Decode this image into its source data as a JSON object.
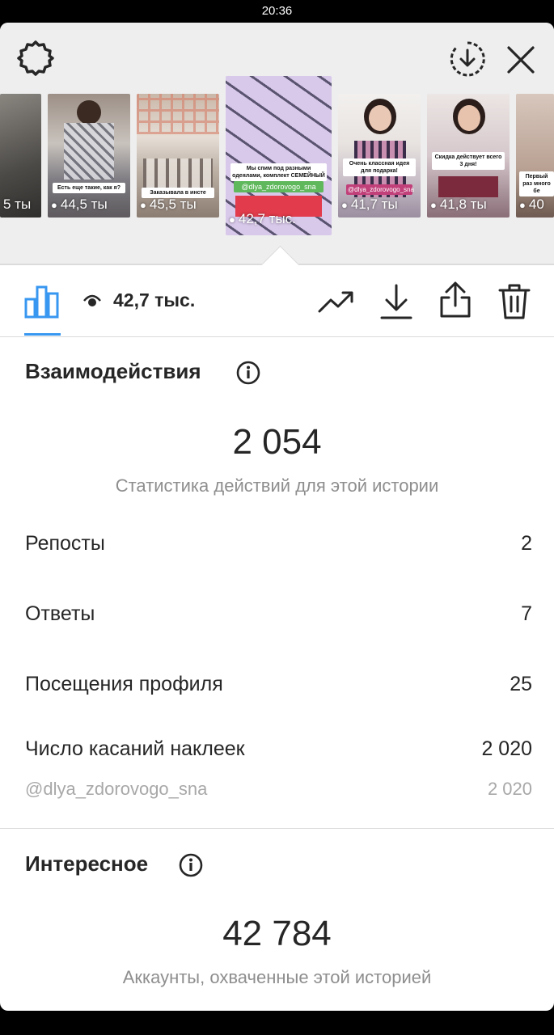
{
  "status_bar": {
    "time": "20:36"
  },
  "header": {
    "thumbnails": [
      {
        "views": "5 ты",
        "caption": "",
        "handle": ""
      },
      {
        "views": "44,5 ты",
        "caption": "Есть еще такие, как я?",
        "handle": ""
      },
      {
        "views": "45,5 ты",
        "caption": "Заказывала в инсте",
        "handle": ""
      },
      {
        "views": "42,7 тыс.",
        "caption": "Мы спим под разными одеялами, комплект СЕМЕЙНЫЙ",
        "handle": "@dlya_zdorovogo_sna"
      },
      {
        "views": "41,7 ты",
        "caption": "Очень классная идея для подарка!",
        "handle": "@dlya_zdorovogo_sna"
      },
      {
        "views": "41,8 ты",
        "caption": "Скидка действует всего 3 дня!",
        "handle": ""
      },
      {
        "views": "40",
        "caption": "Первый раз много бе",
        "handle": ""
      }
    ]
  },
  "toolbar": {
    "views": "42,7 тыс."
  },
  "interactions": {
    "title": "Взаимодействия",
    "total": "2 054",
    "subtitle": "Статистика действий для этой истории",
    "rows": [
      {
        "label": "Репосты",
        "value": "2"
      },
      {
        "label": "Ответы",
        "value": "7"
      },
      {
        "label": "Посещения профиля",
        "value": "25"
      },
      {
        "label": "Число касаний наклеек",
        "value": "2 020"
      }
    ],
    "sticker": {
      "label": "@dlya_zdorovogo_sna",
      "value": "2 020"
    }
  },
  "discovery": {
    "title": "Интересное",
    "total": "42 784",
    "subtitle": "Аккаунты, охваченные этой историей"
  },
  "colors": {
    "accent": "#3897f0",
    "text": "#262626",
    "muted": "#8e8e8e"
  }
}
